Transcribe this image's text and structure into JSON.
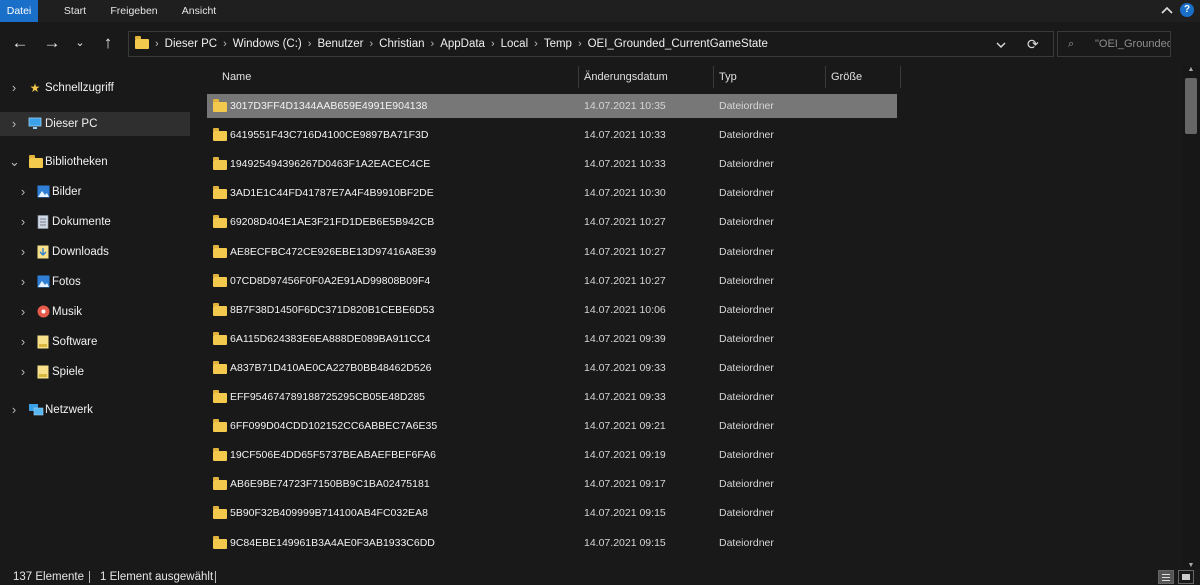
{
  "ribbon": {
    "tabs": [
      "Datei",
      "Start",
      "Freigeben",
      "Ansicht"
    ],
    "active_tab": "Datei",
    "collapse_icon": "chevron-up-icon",
    "help_label": "?"
  },
  "nav": {
    "back_icon": "arrow-left-icon",
    "forward_icon": "arrow-right-icon",
    "recent_icon": "chevron-down-icon",
    "up_icon": "arrow-up-icon"
  },
  "address": {
    "path": [
      "Dieser PC",
      "Windows (C:)",
      "Benutzer",
      "Christian",
      "AppData",
      "Local",
      "Temp",
      "OEI_Grounded_CurrentGameState"
    ],
    "dropdown_icon": "chevron-down-icon",
    "refresh_icon": "refresh-icon"
  },
  "search": {
    "placeholder": "\"OEI_Grounded_Cu..."
  },
  "sidebar": {
    "items": [
      {
        "label": "Schnellzugriff",
        "icon": "star-icon"
      },
      {
        "label": "Dieser PC",
        "icon": "computer-icon"
      },
      {
        "label": "Bibliotheken",
        "icon": "library-icon"
      },
      {
        "label": "Bilder",
        "icon": "pictures-icon"
      },
      {
        "label": "Dokumente",
        "icon": "documents-icon"
      },
      {
        "label": "Downloads",
        "icon": "downloads-icon"
      },
      {
        "label": "Fotos",
        "icon": "photos-icon"
      },
      {
        "label": "Musik",
        "icon": "music-icon"
      },
      {
        "label": "Software",
        "icon": "library-folder-icon"
      },
      {
        "label": "Spiele",
        "icon": "library-folder-icon"
      },
      {
        "label": "Netzwerk",
        "icon": "network-icon"
      }
    ],
    "selected": "Dieser PC"
  },
  "list": {
    "columns": [
      "Name",
      "Änderungsdatum",
      "Typ",
      "Größe"
    ],
    "rows": [
      {
        "name": "3017D3FF4D1344AAB659E4991E904138",
        "date": "14.07.2021 10:35",
        "type": "Dateiordner"
      },
      {
        "name": "6419551F43C716D4100CE9897BA71F3D",
        "date": "14.07.2021 10:33",
        "type": "Dateiordner"
      },
      {
        "name": "194925494396267D0463F1A2EACEC4CE",
        "date": "14.07.2021 10:33",
        "type": "Dateiordner"
      },
      {
        "name": "3AD1E1C44FD41787E7A4F4B9910BF2DE",
        "date": "14.07.2021 10:30",
        "type": "Dateiordner"
      },
      {
        "name": "69208D404E1AE3F21FD1DEB6E5B942CB",
        "date": "14.07.2021 10:27",
        "type": "Dateiordner"
      },
      {
        "name": "AE8ECFBC472CE926EBE13D97416A8E39",
        "date": "14.07.2021 10:27",
        "type": "Dateiordner"
      },
      {
        "name": "07CD8D97456F0F0A2E91AD99808B09F4",
        "date": "14.07.2021 10:27",
        "type": "Dateiordner"
      },
      {
        "name": "8B7F38D1450F6DC371D820B1CEBE6D53",
        "date": "14.07.2021 10:06",
        "type": "Dateiordner"
      },
      {
        "name": "6A115D624383E6EA888DE089BA911CC4",
        "date": "14.07.2021 09:39",
        "type": "Dateiordner"
      },
      {
        "name": "A837B71D410AE0CA227B0BB48462D526",
        "date": "14.07.2021 09:33",
        "type": "Dateiordner"
      },
      {
        "name": "EFF954674789188725295CB05E48D285",
        "date": "14.07.2021 09:33",
        "type": "Dateiordner"
      },
      {
        "name": "6FF099D04CDD102152CC6ABBEC7A6E35",
        "date": "14.07.2021 09:21",
        "type": "Dateiordner"
      },
      {
        "name": "19CF506E4DD65F5737BEABAEFBEF6FA6",
        "date": "14.07.2021 09:19",
        "type": "Dateiordner"
      },
      {
        "name": "AB6E9BE74723F7150BB9C1BA02475181",
        "date": "14.07.2021 09:17",
        "type": "Dateiordner"
      },
      {
        "name": "5B90F32B409999B714100AB4FC032EA8",
        "date": "14.07.2021 09:15",
        "type": "Dateiordner"
      },
      {
        "name": "9C84EBE149961B3A4AE0F3AB1933C6DD",
        "date": "14.07.2021 09:15",
        "type": "Dateiordner"
      }
    ],
    "selected_index": 0,
    "sort_icon": "sort-ascending-icon"
  },
  "status": {
    "count": "137 Elemente",
    "selection": "1 Element ausgewählt",
    "views": [
      "details-view-icon",
      "large-icons-view-icon"
    ]
  },
  "colors": {
    "accent": "#1a6fc9",
    "folder": "#f2c94c",
    "background": "#191919",
    "selected_row": "#777777"
  }
}
